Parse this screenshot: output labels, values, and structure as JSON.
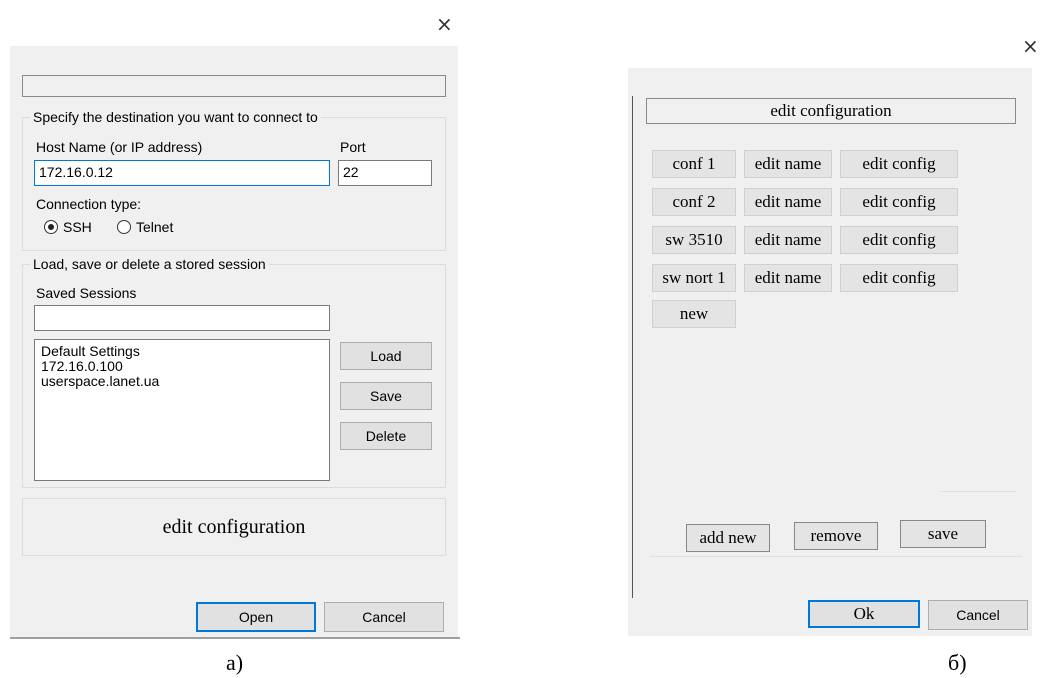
{
  "left_dialog": {
    "close_glyph": "×",
    "group_destination": {
      "title": "Specify the destination you want to connect to",
      "host_label": "Host Name (or IP address)",
      "host_value": "172.16.0.12",
      "port_label": "Port",
      "port_value": "22",
      "connection_type_label": "Connection type:",
      "radio_ssh": "SSH",
      "radio_telnet": "Telnet",
      "selected": "SSH"
    },
    "group_sessions": {
      "title": "Load, save or delete a stored session",
      "saved_sessions_label": "Saved Sessions",
      "saved_sessions_value": "",
      "sessions": [
        "Default Settings",
        "172.16.0.100",
        "userspace.lanet.ua"
      ],
      "load_label": "Load",
      "save_label": "Save",
      "delete_label": "Delete"
    },
    "edit_configuration_label": "edit configuration",
    "open_label": "Open",
    "cancel_label": "Cancel",
    "caption": "а)"
  },
  "right_dialog": {
    "close_glyph": "×",
    "header_label": "edit configuration",
    "configs": [
      {
        "name": "conf 1",
        "edit_name": "edit name",
        "edit_config": "edit config"
      },
      {
        "name": "conf 2",
        "edit_name": "edit name",
        "edit_config": "edit config"
      },
      {
        "name": "sw 3510",
        "edit_name": "edit name",
        "edit_config": "edit config"
      },
      {
        "name": "sw nort 1",
        "edit_name": "edit name",
        "edit_config": "edit config"
      }
    ],
    "new_label": "new",
    "add_new_label": "add new",
    "remove_label": "remove",
    "save_label": "save",
    "ok_label": "Ok",
    "cancel_label": "Cancel",
    "caption": "б)"
  },
  "colors": {
    "window_bg": "#f0f0f0",
    "focus_blue": "#0078d7",
    "button_bg": "#e1e1e1"
  }
}
